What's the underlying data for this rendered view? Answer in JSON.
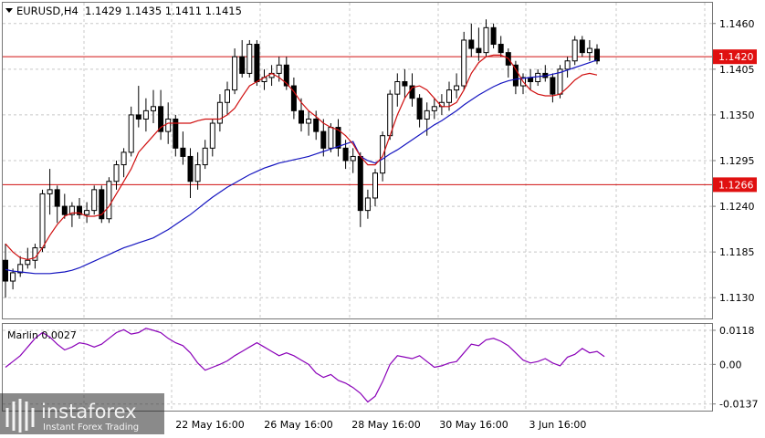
{
  "chart_data": [
    {
      "type": "candlestick",
      "title": "EURUSD,H4",
      "ohlc_readout": "1.1429 1.1435 1.1411 1.1415",
      "ylim": [
        1.1105,
        1.1485
      ],
      "y_ticks": [
        "1.1460",
        "1.1405",
        "1.1350",
        "1.1295",
        "1.1240",
        "1.1185",
        "1.1130"
      ],
      "x_ticks": [
        "22 May 16:00",
        "26 May 16:00",
        "28 May 16:00",
        "30 May 16:00",
        "3 Jun 16:00"
      ],
      "levels": [
        {
          "value": 1.142,
          "label": "1.1420",
          "color": "#d01010"
        },
        {
          "value": 1.1266,
          "label": "1.1266",
          "color": "#d01010"
        }
      ],
      "candles": [
        [
          1.1175,
          1.1195,
          1.113,
          1.115
        ],
        [
          1.115,
          1.1165,
          1.114,
          1.116
        ],
        [
          1.116,
          1.118,
          1.1155,
          1.117
        ],
        [
          1.117,
          1.119,
          1.1165,
          1.1175
        ],
        [
          1.1175,
          1.1195,
          1.1165,
          1.119
        ],
        [
          1.119,
          1.126,
          1.1185,
          1.1255
        ],
        [
          1.1255,
          1.1285,
          1.123,
          1.126
        ],
        [
          1.126,
          1.1265,
          1.122,
          1.124
        ],
        [
          1.124,
          1.1255,
          1.1225,
          1.123
        ],
        [
          1.123,
          1.1245,
          1.1215,
          1.124
        ],
        [
          1.124,
          1.125,
          1.1225,
          1.123
        ],
        [
          1.123,
          1.1245,
          1.122,
          1.1235
        ],
        [
          1.1235,
          1.1265,
          1.123,
          1.126
        ],
        [
          1.126,
          1.1265,
          1.122,
          1.1225
        ],
        [
          1.1225,
          1.1275,
          1.122,
          1.127
        ],
        [
          1.127,
          1.1295,
          1.126,
          1.129
        ],
        [
          1.129,
          1.131,
          1.1275,
          1.1305
        ],
        [
          1.1305,
          1.136,
          1.13,
          1.135
        ],
        [
          1.135,
          1.1385,
          1.1335,
          1.1345
        ],
        [
          1.1345,
          1.137,
          1.133,
          1.1355
        ],
        [
          1.1355,
          1.138,
          1.134,
          1.136
        ],
        [
          1.136,
          1.138,
          1.132,
          1.133
        ],
        [
          1.133,
          1.1365,
          1.1315,
          1.1345
        ],
        [
          1.1345,
          1.135,
          1.13,
          1.131
        ],
        [
          1.131,
          1.133,
          1.129,
          1.13
        ],
        [
          1.13,
          1.131,
          1.125,
          1.127
        ],
        [
          1.127,
          1.1305,
          1.126,
          1.129
        ],
        [
          1.129,
          1.132,
          1.1285,
          1.131
        ],
        [
          1.131,
          1.1345,
          1.13,
          1.134
        ],
        [
          1.134,
          1.1375,
          1.133,
          1.1365
        ],
        [
          1.1365,
          1.139,
          1.135,
          1.138
        ],
        [
          1.138,
          1.143,
          1.1375,
          1.142
        ],
        [
          1.142,
          1.144,
          1.1395,
          1.14
        ],
        [
          1.14,
          1.144,
          1.1395,
          1.1435
        ],
        [
          1.1435,
          1.144,
          1.1385,
          1.139
        ],
        [
          1.139,
          1.1405,
          1.138,
          1.1395
        ],
        [
          1.1395,
          1.141,
          1.1385,
          1.14
        ],
        [
          1.14,
          1.142,
          1.139,
          1.141
        ],
        [
          1.141,
          1.142,
          1.138,
          1.1385
        ],
        [
          1.1385,
          1.1395,
          1.1345,
          1.1355
        ],
        [
          1.1355,
          1.137,
          1.133,
          1.134
        ],
        [
          1.134,
          1.1355,
          1.1325,
          1.1345
        ],
        [
          1.1345,
          1.1355,
          1.132,
          1.133
        ],
        [
          1.133,
          1.1345,
          1.13,
          1.131
        ],
        [
          1.131,
          1.134,
          1.1305,
          1.1335
        ],
        [
          1.1335,
          1.1345,
          1.13,
          1.131
        ],
        [
          1.131,
          1.132,
          1.1285,
          1.1295
        ],
        [
          1.1295,
          1.131,
          1.128,
          1.13
        ],
        [
          1.13,
          1.1305,
          1.1215,
          1.1235
        ],
        [
          1.1235,
          1.126,
          1.1225,
          1.125
        ],
        [
          1.125,
          1.1285,
          1.124,
          1.128
        ],
        [
          1.128,
          1.133,
          1.127,
          1.1325
        ],
        [
          1.1325,
          1.138,
          1.132,
          1.1375
        ],
        [
          1.1375,
          1.14,
          1.136,
          1.139
        ],
        [
          1.139,
          1.1405,
          1.137,
          1.1385
        ],
        [
          1.1385,
          1.14,
          1.136,
          1.137
        ],
        [
          1.137,
          1.1375,
          1.1335,
          1.1345
        ],
        [
          1.1345,
          1.1365,
          1.1325,
          1.1355
        ],
        [
          1.1355,
          1.137,
          1.1345,
          1.136
        ],
        [
          1.136,
          1.1375,
          1.135,
          1.1365
        ],
        [
          1.1365,
          1.139,
          1.1355,
          1.138
        ],
        [
          1.138,
          1.14,
          1.137,
          1.1385
        ],
        [
          1.1385,
          1.145,
          1.138,
          1.144
        ],
        [
          1.144,
          1.146,
          1.142,
          1.143
        ],
        [
          1.143,
          1.1455,
          1.1415,
          1.1425
        ],
        [
          1.1425,
          1.1465,
          1.142,
          1.1455
        ],
        [
          1.1455,
          1.146,
          1.143,
          1.1435
        ],
        [
          1.1435,
          1.1445,
          1.142,
          1.1425
        ],
        [
          1.1425,
          1.143,
          1.1395,
          1.141
        ],
        [
          1.141,
          1.1415,
          1.1375,
          1.1385
        ],
        [
          1.1385,
          1.14,
          1.1375,
          1.1395
        ],
        [
          1.1395,
          1.1405,
          1.138,
          1.139
        ],
        [
          1.139,
          1.1405,
          1.1385,
          1.14
        ],
        [
          1.14,
          1.141,
          1.139,
          1.1395
        ],
        [
          1.1395,
          1.14,
          1.1365,
          1.1375
        ],
        [
          1.1375,
          1.141,
          1.137,
          1.1405
        ],
        [
          1.1405,
          1.142,
          1.1395,
          1.1415
        ],
        [
          1.1415,
          1.1445,
          1.141,
          1.144
        ],
        [
          1.144,
          1.1445,
          1.142,
          1.1425
        ],
        [
          1.1425,
          1.144,
          1.1415,
          1.143
        ],
        [
          1.1429,
          1.1435,
          1.1411,
          1.1415
        ]
      ],
      "ma_red": [
        1.1195,
        1.1185,
        1.1178,
        1.1176,
        1.1178,
        1.119,
        1.1205,
        1.1218,
        1.1228,
        1.1232,
        1.1232,
        1.1228,
        1.1228,
        1.123,
        1.124,
        1.1255,
        1.127,
        1.1285,
        1.1305,
        1.1315,
        1.1325,
        1.1335,
        1.134,
        1.134,
        1.134,
        1.134,
        1.1343,
        1.1345,
        1.1345,
        1.1345,
        1.135,
        1.1358,
        1.1372,
        1.1385,
        1.139,
        1.1395,
        1.14,
        1.1395,
        1.1388,
        1.1378,
        1.1365,
        1.1355,
        1.1348,
        1.134,
        1.1335,
        1.1332,
        1.1325,
        1.1315,
        1.13,
        1.129,
        1.129,
        1.13,
        1.1325,
        1.135,
        1.137,
        1.1383,
        1.1385,
        1.138,
        1.137,
        1.136,
        1.136,
        1.1365,
        1.138,
        1.14,
        1.1413,
        1.142,
        1.1422,
        1.1422,
        1.1418,
        1.1405,
        1.139,
        1.138,
        1.1375,
        1.1373,
        1.1373,
        1.1375,
        1.1383,
        1.1392,
        1.1398,
        1.14,
        1.1398
      ],
      "ma_blue": [
        1.1164,
        1.1162,
        1.1161,
        1.116,
        1.1159,
        1.1159,
        1.1159,
        1.116,
        1.1161,
        1.1163,
        1.1166,
        1.117,
        1.1174,
        1.1178,
        1.1182,
        1.1186,
        1.119,
        1.1193,
        1.1196,
        1.1199,
        1.1202,
        1.1207,
        1.1212,
        1.1218,
        1.1224,
        1.123,
        1.1237,
        1.1244,
        1.1251,
        1.1257,
        1.1263,
        1.1268,
        1.1273,
        1.1278,
        1.1282,
        1.1286,
        1.1289,
        1.1292,
        1.1294,
        1.1296,
        1.1298,
        1.13,
        1.1303,
        1.1306,
        1.1309,
        1.1312,
        1.1315,
        1.1318,
        1.13,
        1.1295,
        1.1292,
        1.1297,
        1.1303,
        1.1308,
        1.1314,
        1.132,
        1.1326,
        1.1332,
        1.1338,
        1.1343,
        1.1349,
        1.1355,
        1.1362,
        1.1368,
        1.1374,
        1.1379,
        1.1384,
        1.1388,
        1.1391,
        1.1393,
        1.1394,
        1.1395,
        1.1396,
        1.1397,
        1.1399,
        1.1401,
        1.1404,
        1.1407,
        1.141,
        1.1413,
        1.1416
      ]
    },
    {
      "type": "line",
      "label": "Marlin 0.0027",
      "ylim": [
        -0.016,
        0.014
      ],
      "y_ticks": [
        "0.0118",
        "0.00",
        "-0.0137"
      ],
      "series": [
        -0.001,
        0.001,
        0.003,
        0.006,
        0.009,
        0.011,
        0.0095,
        0.007,
        0.005,
        0.006,
        0.0075,
        0.007,
        0.006,
        0.007,
        0.009,
        0.011,
        0.012,
        0.0105,
        0.011,
        0.0125,
        0.0118,
        0.011,
        0.009,
        0.0075,
        0.0065,
        0.004,
        0.0005,
        -0.002,
        -0.001,
        0.0,
        0.0012,
        0.003,
        0.0045,
        0.006,
        0.0075,
        0.006,
        0.0045,
        0.003,
        0.004,
        0.003,
        0.0015,
        0.0,
        -0.003,
        -0.0045,
        -0.0035,
        -0.0055,
        -0.0065,
        -0.008,
        -0.01,
        -0.013,
        -0.011,
        -0.006,
        0.0,
        0.003,
        0.0025,
        0.002,
        0.003,
        0.001,
        -0.001,
        -0.0005,
        0.0005,
        0.001,
        0.004,
        0.007,
        0.0065,
        0.0085,
        0.009,
        0.008,
        0.0065,
        0.004,
        0.0015,
        0.0005,
        0.001,
        0.002,
        0.0005,
        -0.0005,
        0.0025,
        0.0035,
        0.0055,
        0.004,
        0.0045,
        0.0027
      ]
    }
  ],
  "watermark": {
    "brand": "instaforex",
    "tagline": "Instant Forex Trading"
  },
  "colors": {
    "grid": "#c8c8c8",
    "axis": "#777777",
    "bull_fill": "#ffffff",
    "bear_fill": "#000000",
    "candle_stroke": "#000000",
    "ma_red": "#d01010",
    "ma_blue": "#1515c0",
    "oscillator": "#8a00b8",
    "level_tag_bg": "#e01010",
    "level_tag_text": "#ffffff"
  }
}
